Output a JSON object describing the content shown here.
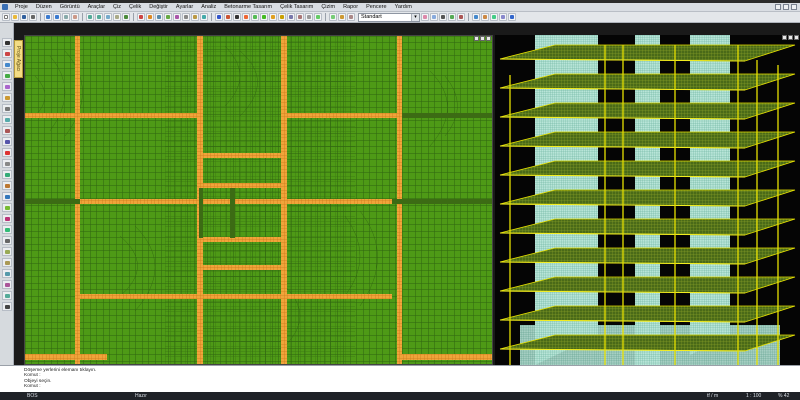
{
  "menu": [
    "Proje",
    "Düzen",
    "Görüntü",
    "Araçlar",
    "Çiz",
    "Çelik",
    "Değiştir",
    "Ayarlar",
    "Analiz",
    "Betonarme Tasarım",
    "Çelik Tasarım",
    "Çizim",
    "Rapor",
    "Pencere",
    "Yardım"
  ],
  "toolbar": {
    "view_select": "Standart"
  },
  "side_tab": "Proje Ağacı",
  "command_lines": [
    "Döşeme yerlerini elemanı tıklayın.",
    "Komut :",
    "Objeyi seçin.",
    "Komut :"
  ],
  "status": {
    "left": "BOS",
    "mode": "Hazır",
    "units": "tf / m",
    "scale": "1 : 100",
    "zoom": "% 42"
  },
  "colors": {
    "plan_fill": "#4e9a16",
    "mesh_line": "#2f6410",
    "beam": "#f0a43a",
    "beam_mesh": "#c97618",
    "wall_fill": "#b8e5d8",
    "slab_yellow": "#e6e000",
    "background_3d": "#050505"
  }
}
